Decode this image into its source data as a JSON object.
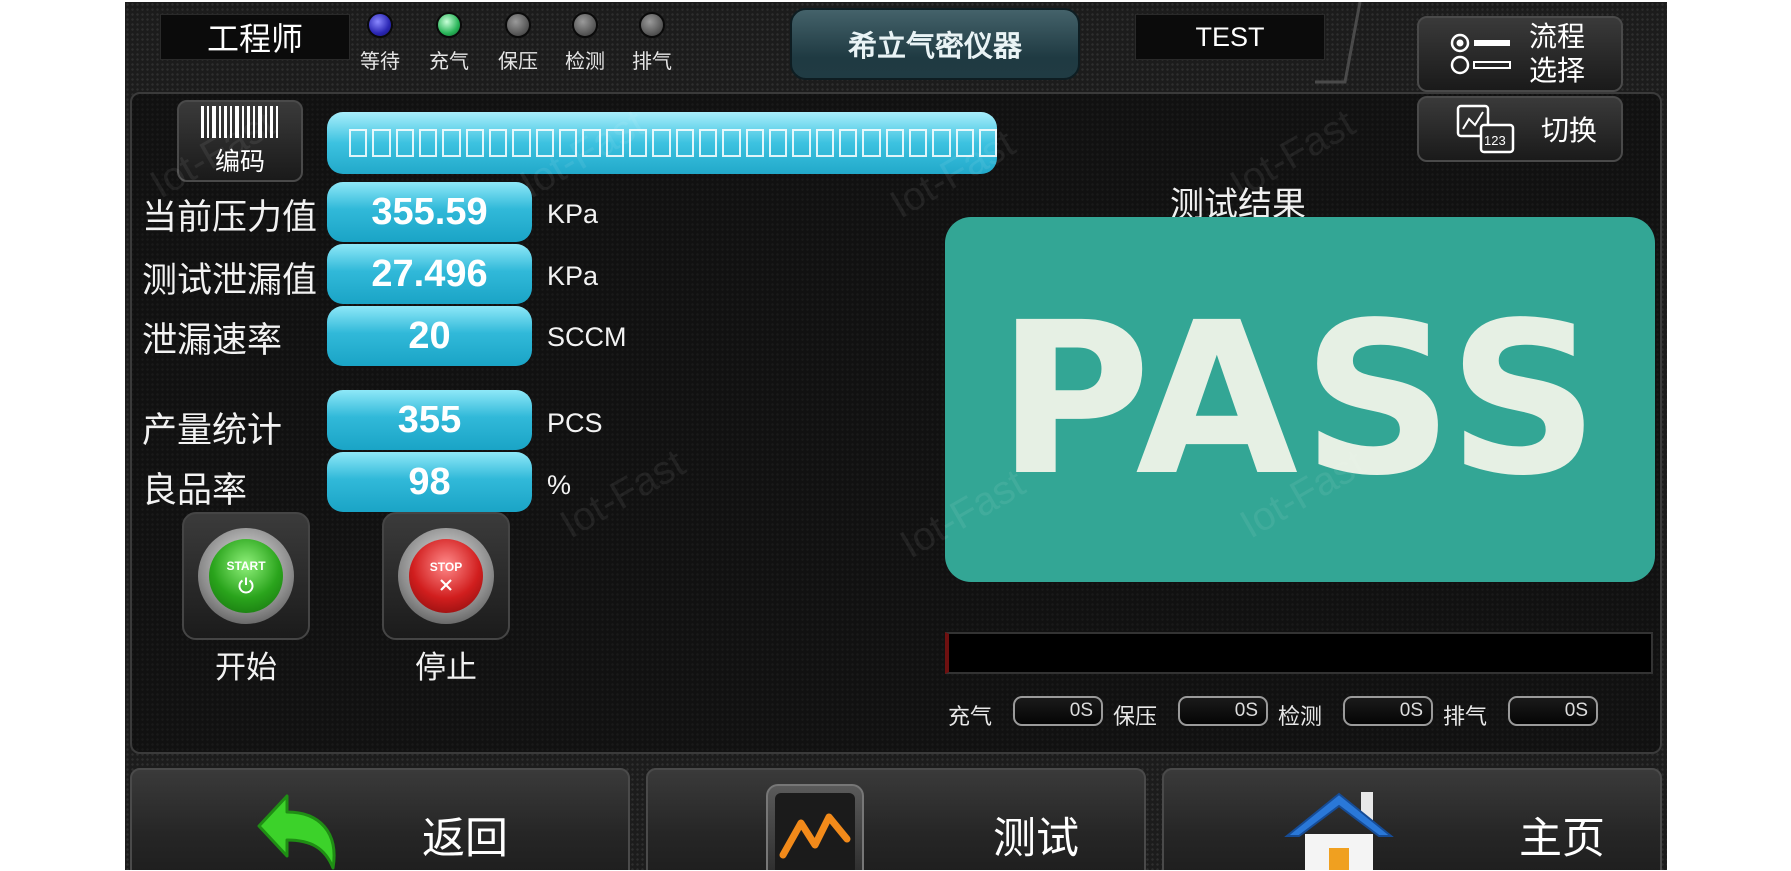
{
  "header": {
    "role": "工程师",
    "title": "希立气密仪器",
    "mode": "TEST",
    "steps": [
      {
        "label": "等待",
        "state": "blue"
      },
      {
        "label": "充气",
        "state": "green"
      },
      {
        "label": "保压",
        "state": "gray"
      },
      {
        "label": "检测",
        "state": "gray"
      },
      {
        "label": "排气",
        "state": "gray"
      }
    ],
    "flow_select": {
      "line1": "流程",
      "line2": "选择"
    },
    "switch_label": "切换"
  },
  "barcode": {
    "label": "编码",
    "value_box_count": 28
  },
  "readings": {
    "pressure": {
      "label": "当前压力值",
      "value": "355.59",
      "unit": "KPa"
    },
    "leak": {
      "label": "测试泄漏值",
      "value": "27.496",
      "unit": "KPa"
    },
    "leak_rate": {
      "label": "泄漏速率",
      "value": "20",
      "unit": "SCCM"
    },
    "output": {
      "label": "产量统计",
      "value": "355",
      "unit": "PCS"
    },
    "yield": {
      "label": "良品率",
      "value": "98",
      "unit": "%"
    }
  },
  "controls": {
    "start": {
      "caption": "开始",
      "face": "START"
    },
    "stop": {
      "caption": "停止",
      "face": "STOP"
    }
  },
  "result": {
    "title": "测试结果",
    "value": "PASS",
    "color": "#33a695"
  },
  "timers": [
    {
      "label": "充气",
      "value": "0S"
    },
    {
      "label": "保压",
      "value": "0S"
    },
    {
      "label": "检测",
      "value": "0S"
    },
    {
      "label": "排气",
      "value": "0S"
    }
  ],
  "nav": {
    "back": "返回",
    "test": "测试",
    "home": "主页"
  },
  "watermark": "Iot-Fast"
}
